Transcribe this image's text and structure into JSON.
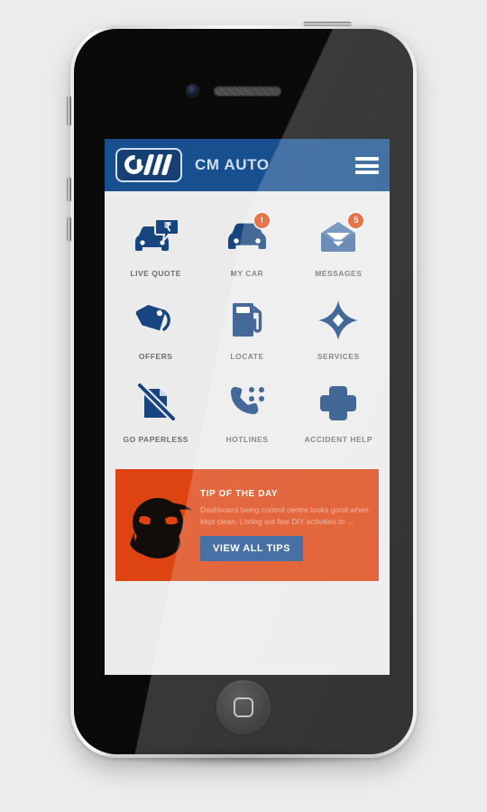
{
  "app": {
    "title": "CM AUTO",
    "logo_name": "cm-auto-logo",
    "menu_icon": "hamburger-menu-icon",
    "header_color": "#18508f",
    "accent_color": "#1d4f91",
    "badge_color": "#e0531f",
    "screen_background": "#ebebeb"
  },
  "grid": {
    "rows": [
      [
        {
          "label": "LIVE QUOTE",
          "icon": "car-quote-icon",
          "badge": null
        },
        {
          "label": "MY CAR",
          "icon": "car-icon",
          "badge": "!"
        },
        {
          "label": "MESSAGES",
          "icon": "envelope-icon",
          "badge": "5"
        }
      ],
      [
        {
          "label": "OFFERS",
          "icon": "price-tag-icon",
          "badge": null
        },
        {
          "label": "LOCATE",
          "icon": "fuel-pump-icon",
          "badge": null
        },
        {
          "label": "SERVICES",
          "icon": "compass-star-icon",
          "badge": null
        }
      ],
      [
        {
          "label": "GO PAPERLESS",
          "icon": "document-slash-icon",
          "badge": null
        },
        {
          "label": "HOTLINES",
          "icon": "phone-dots-icon",
          "badge": null
        },
        {
          "label": "ACCIDENT HELP",
          "icon": "medical-cross-icon",
          "badge": null
        }
      ]
    ]
  },
  "tip": {
    "title": "TIP OF THE DAY",
    "text": "Dashboard being control centre looks good when kept clean. Listing out few DIY activities to ...",
    "button_label": "VIEW ALL TIPS",
    "mascot_icon": "ninja-mascot-icon",
    "card_color": "#dd4411"
  },
  "device": {
    "camera": "front-camera",
    "speaker": "earpiece-speaker",
    "home_button": "home-button",
    "mute_switch": "mute-switch",
    "volume_up": "volume-up-button",
    "volume_down": "volume-down-button",
    "power": "power-button"
  }
}
